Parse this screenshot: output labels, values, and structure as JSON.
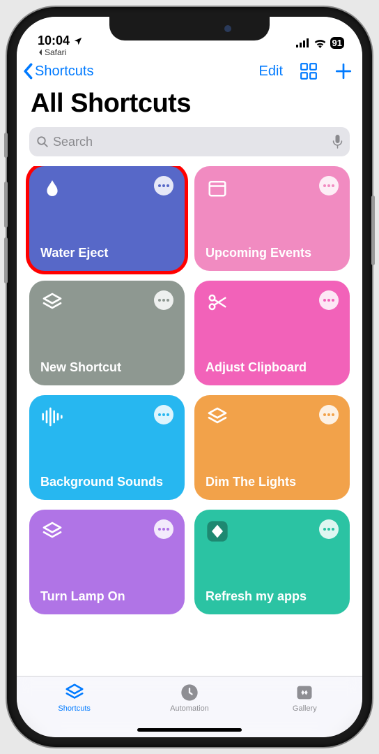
{
  "status": {
    "time": "10:04",
    "back_app": "Safari",
    "battery": "91"
  },
  "nav": {
    "back_label": "Shortcuts",
    "edit_label": "Edit"
  },
  "page": {
    "title": "All Shortcuts"
  },
  "search": {
    "placeholder": "Search"
  },
  "shortcuts": [
    {
      "label": "Water Eject",
      "color": "#5768c8",
      "icon": "drop",
      "highlighted": true
    },
    {
      "label": "Upcoming Events",
      "color": "#f18bc1",
      "icon": "calendar",
      "highlighted": false
    },
    {
      "label": "New Shortcut",
      "color": "#8e9891",
      "icon": "layers",
      "highlighted": false
    },
    {
      "label": "Adjust Clipboard",
      "color": "#f262b9",
      "icon": "scissors",
      "highlighted": false
    },
    {
      "label": "Background Sounds",
      "color": "#27b7f0",
      "icon": "waveform",
      "highlighted": false
    },
    {
      "label": "Dim The Lights",
      "color": "#f2a24a",
      "icon": "layers",
      "highlighted": false
    },
    {
      "label": "Turn Lamp On",
      "color": "#b074e6",
      "icon": "layers",
      "highlighted": false
    },
    {
      "label": "Refresh my apps",
      "color": "#2bc3a3",
      "icon": "diamond",
      "highlighted": false
    }
  ],
  "tabs": [
    {
      "label": "Shortcuts",
      "icon": "layers",
      "active": true
    },
    {
      "label": "Automation",
      "icon": "clock",
      "active": false
    },
    {
      "label": "Gallery",
      "icon": "gallery",
      "active": false
    }
  ]
}
